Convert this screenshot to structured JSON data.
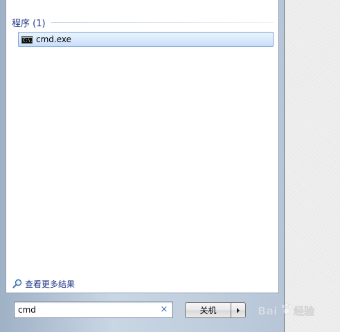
{
  "results": {
    "group_title": "程序 (1)",
    "items": [
      {
        "label": "cmd.exe",
        "icon": "cmd-console-icon",
        "icon_text": "C:\\."
      }
    ]
  },
  "see_more": {
    "label": "查看更多结果",
    "icon": "magnifier-icon"
  },
  "search": {
    "value": "cmd",
    "clear_icon": "×"
  },
  "shutdown": {
    "label": "关机",
    "arrow_icon": "chevron-right-icon"
  },
  "watermark": {
    "text": "Baidu 经验"
  },
  "colors": {
    "accent_text": "#1e3287",
    "selection_border": "#7da2ce",
    "frame": "#b7c6d7"
  }
}
